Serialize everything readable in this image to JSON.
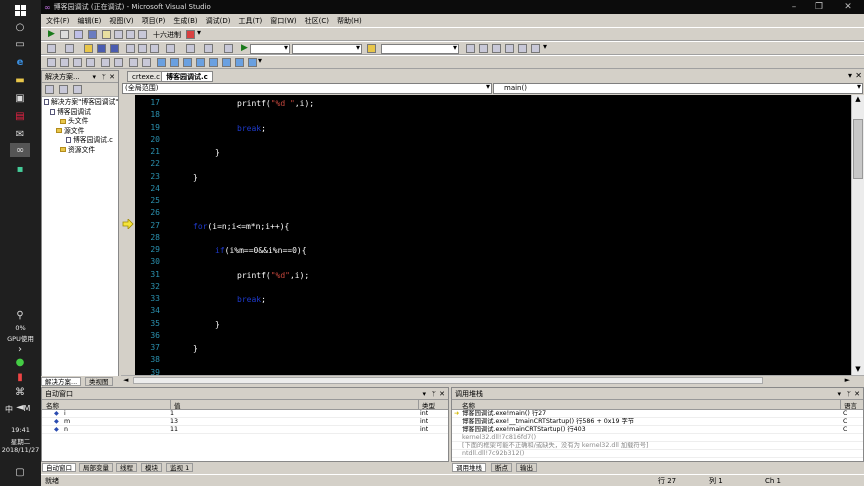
{
  "taskbar": {
    "gpu_percent": "0%",
    "gpu_label": "GPU使用",
    "ime": "中",
    "ime_mode": "M",
    "time": "19:41",
    "weekday": "星期二",
    "date": "2018/11/27"
  },
  "window": {
    "title": "博客园调试 (正在调试) - Microsoft Visual Studio"
  },
  "menu": [
    "文件(F)",
    "编辑(E)",
    "视图(V)",
    "项目(P)",
    "生成(B)",
    "调试(D)",
    "工具(T)",
    "窗口(W)",
    "社区(C)",
    "帮助(H)"
  ],
  "toolbar": {
    "hex_label": "十六进制"
  },
  "solution": {
    "title": "解决方案...",
    "tree": [
      "解决方案\"博客园调试\"",
      "博客园调试",
      "头文件",
      "源文件",
      "博客园调试.c",
      "资源文件"
    ],
    "tabs": [
      "解决方案...",
      "类视图"
    ]
  },
  "editor": {
    "tabs": [
      "crtexe.c",
      "博客园调试.c"
    ],
    "scope": "(全局范围)",
    "function": "main()",
    "current_line": 27,
    "lines": [
      {
        "n": "17",
        "indent": 3,
        "parts": [
          {
            "t": "printf(",
            "c": "n"
          },
          {
            "t": "\"%d \"",
            "c": "s"
          },
          {
            "t": ",i);",
            "c": "n"
          }
        ]
      },
      {
        "n": "18",
        "indent": 0,
        "parts": []
      },
      {
        "n": "19",
        "indent": 3,
        "parts": [
          {
            "t": "break",
            "c": "k"
          },
          {
            "t": ";",
            "c": "n"
          }
        ]
      },
      {
        "n": "20",
        "indent": 0,
        "parts": []
      },
      {
        "n": "21",
        "indent": 2,
        "parts": [
          {
            "t": "}",
            "c": "n"
          }
        ]
      },
      {
        "n": "22",
        "indent": 0,
        "parts": []
      },
      {
        "n": "23",
        "indent": 1,
        "parts": [
          {
            "t": "}",
            "c": "n"
          }
        ]
      },
      {
        "n": "24",
        "indent": 0,
        "parts": []
      },
      {
        "n": "25",
        "indent": 0,
        "parts": []
      },
      {
        "n": "26",
        "indent": 0,
        "parts": []
      },
      {
        "n": "27",
        "indent": 1,
        "parts": [
          {
            "t": "for",
            "c": "k"
          },
          {
            "t": "(i=n;i<=m*n;i++){",
            "c": "n"
          }
        ]
      },
      {
        "n": "28",
        "indent": 0,
        "parts": []
      },
      {
        "n": "29",
        "indent": 2,
        "parts": [
          {
            "t": "if",
            "c": "k"
          },
          {
            "t": "(i%m==0&&i%n==0){",
            "c": "n"
          }
        ]
      },
      {
        "n": "30",
        "indent": 0,
        "parts": []
      },
      {
        "n": "31",
        "indent": 3,
        "parts": [
          {
            "t": "printf(",
            "c": "n"
          },
          {
            "t": "\"%d\"",
            "c": "s"
          },
          {
            "t": ",i);",
            "c": "n"
          }
        ]
      },
      {
        "n": "32",
        "indent": 0,
        "parts": []
      },
      {
        "n": "33",
        "indent": 3,
        "parts": [
          {
            "t": "break",
            "c": "k"
          },
          {
            "t": ";",
            "c": "n"
          }
        ]
      },
      {
        "n": "34",
        "indent": 0,
        "parts": []
      },
      {
        "n": "35",
        "indent": 2,
        "parts": [
          {
            "t": "}",
            "c": "n"
          }
        ]
      },
      {
        "n": "36",
        "indent": 0,
        "parts": []
      },
      {
        "n": "37",
        "indent": 1,
        "parts": [
          {
            "t": "}",
            "c": "n"
          }
        ]
      },
      {
        "n": "38",
        "indent": 0,
        "parts": []
      },
      {
        "n": "39",
        "indent": 0,
        "parts": []
      }
    ]
  },
  "autos": {
    "title": "自动窗口",
    "headers": [
      "名称",
      "值",
      "类型"
    ],
    "rows": [
      [
        "i",
        "1",
        "int"
      ],
      [
        "m",
        "13",
        "int"
      ],
      [
        "n",
        "11",
        "int"
      ]
    ],
    "tabs": [
      "自动窗口",
      "局部变量",
      "线程",
      "模块",
      "监视 1"
    ]
  },
  "callstack": {
    "title": "调用堆栈",
    "headers": [
      "名称",
      "语言"
    ],
    "rows": [
      [
        "博客园调试.exe!main()  行27",
        "C"
      ],
      [
        "博客园调试.exe!__tmainCRTStartup()  行586 + 0x19 字节",
        "C"
      ],
      [
        "博客园调试.exe!mainCRTStartup()  行403",
        "C"
      ],
      [
        "kernel32.dll!7c816fd7()",
        ""
      ],
      [
        "[下面的框架可能不正确和/或缺失，没有为 kernel32.dll 加载符号]",
        ""
      ],
      [
        "ntdll.dll!7c92b312()",
        ""
      ]
    ],
    "tabs": [
      "调用堆栈",
      "断点",
      "输出"
    ]
  },
  "status": {
    "ready": "就绪",
    "line": "行 27",
    "col": "列 1",
    "ch": "Ch 1"
  }
}
